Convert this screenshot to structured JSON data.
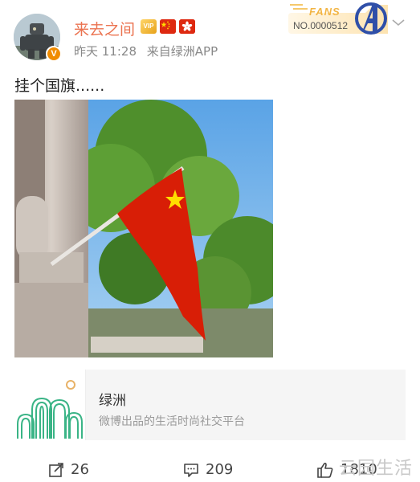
{
  "user": {
    "name": "来去之间",
    "avatar_icon": "robot-avatar",
    "verified_badge": "V",
    "badge_icons": [
      "vip-badge-icon",
      "china-flag-icon",
      "hong-kong-flag-icon"
    ],
    "vip_text": "VIP",
    "name_color": "#eb7350"
  },
  "meta": {
    "time": "昨天 11:28",
    "source": "来自绿洲APP"
  },
  "fans_badge": {
    "label": "FANS",
    "number": "NO.0000512",
    "icon": "avengers-logo-icon"
  },
  "more_menu_icon": "chevron-down-icon",
  "post": {
    "text": "挂个国旗......",
    "image": "red-flag-on-building-photo"
  },
  "card": {
    "title": "绿洲",
    "subtitle": "微博出品的生活时尚社交平台",
    "logo_icon": "oasis-logo-icon",
    "logo_color": "#3ab486"
  },
  "actions": {
    "repost_count": "26",
    "comment_count": "209",
    "like_count": "1810"
  },
  "watermark": "云园生活"
}
